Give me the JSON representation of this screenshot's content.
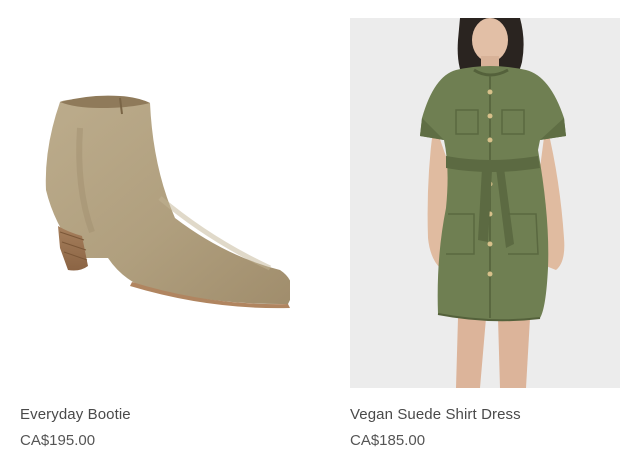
{
  "products": [
    {
      "name": "Everyday Bootie",
      "price": "CA$195.00",
      "image_icon": "suede-ankle-bootie-image",
      "color": "#b19f80"
    },
    {
      "name": "Vegan Suede Shirt Dress",
      "price": "CA$185.00",
      "image_icon": "olive-shirt-dress-image",
      "color": "#6f7f52"
    }
  ]
}
